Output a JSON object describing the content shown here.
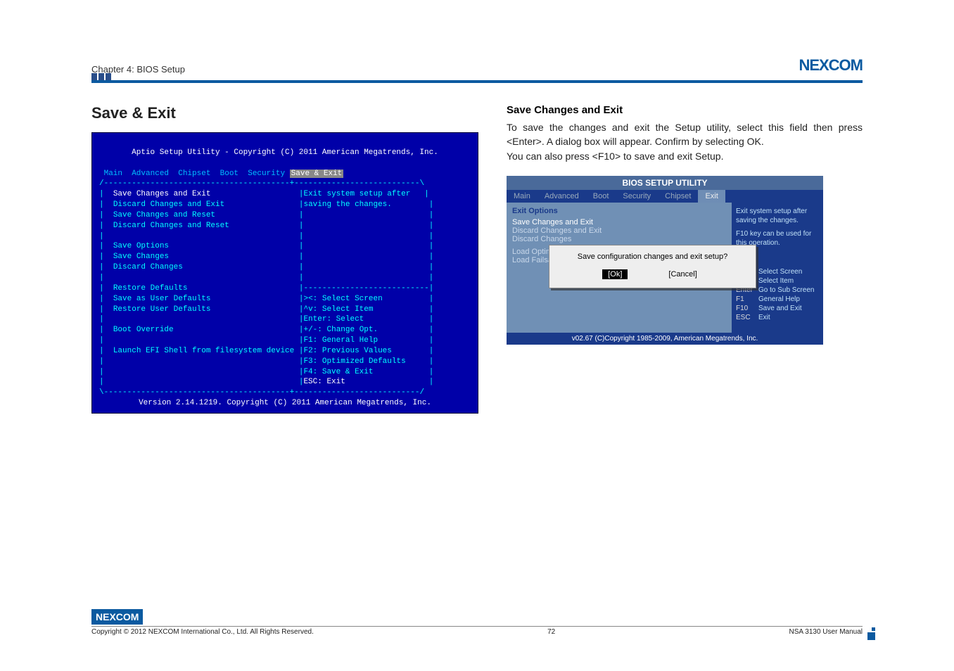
{
  "header": {
    "chapter": "Chapter 4: BIOS Setup",
    "logo_text": "NEXCOM"
  },
  "left": {
    "heading": "Save & Exit",
    "bios": {
      "title": "Aptio Setup Utility - Copyright (C) 2011 American Megatrends, Inc.",
      "tabs": " Main  Advanced  Chipset  Boot  Security ",
      "tab_active": "Save & Exit",
      "menu": {
        "m1": "Save Changes and Exit",
        "m2": "Discard Changes and Exit",
        "m3": "Save Changes and Reset",
        "m4": "Discard Changes and Reset",
        "g1": "Save Options",
        "m5": "Save Changes",
        "m6": "Discard Changes",
        "m7": "Restore Defaults",
        "m8": "Save as User Defaults",
        "m9": "Restore User Defaults",
        "g2": "Boot Override",
        "m10": "Launch EFI Shell from filesystem device"
      },
      "help1": "Exit system setup after",
      "help2": "saving the changes.",
      "keys": {
        "k1": "><: Select Screen",
        "k2": "^v: Select Item",
        "k3": "Enter: Select",
        "k4": "+/-: Change Opt.",
        "k5": "F1: General Help",
        "k6": "F2: Previous Values",
        "k7": "F3: Optimized Defaults",
        "k8": "F4: Save & Exit",
        "k9": "ESC: Exit"
      },
      "footer": "Version 2.14.1219. Copyright (C) 2011 American Megatrends, Inc."
    }
  },
  "right": {
    "title": "Save Changes and Exit",
    "body1": "To save the changes and exit the Setup utility, select this field then press <Enter>. A dialog box will appear. Confirm by selecting OK.",
    "body2": "You can also press <F10> to save and exit Setup.",
    "bios2": {
      "header": "BIOS SETUP UTILITY",
      "tabs": {
        "t1": "Main",
        "t2": "Advanced",
        "t3": "Boot",
        "t4": "Security",
        "t5": "Chipset",
        "t6": "Exit"
      },
      "left": {
        "head": "Exit Options",
        "i1": "Save Changes and Exit",
        "i2": "Discard Changes and Exit",
        "i3": "Discard Changes",
        "i4": "Load Optimal D",
        "i5": "Load Failsafe D"
      },
      "rightpanel": {
        "l1": "Exit system setup after saving the changes.",
        "l2": "F10 key can be used for this operation.",
        "h1": "Select Screen",
        "h2": "Select Item",
        "h3": "Go to Sub Screen",
        "h4": "General Help",
        "h5": "Save and Exit",
        "h6": "Exit",
        "k1": "↑↓",
        "k2": "↔",
        "k3": "Enter",
        "k4": "F1",
        "k5": "F10",
        "k6": "ESC"
      },
      "dialog": {
        "msg": "Save configuration changes and exit setup?",
        "ok": "[Ok]",
        "cancel": "[Cancel]"
      },
      "footer": "v02.67 (C)Copyright 1985-2009, American Megatrends, Inc."
    }
  },
  "footer": {
    "logo": "NEXCOM",
    "copyright": "Copyright © 2012 NEXCOM International Co., Ltd. All Rights Reserved.",
    "page": "72",
    "manual": "NSA 3130 User Manual"
  }
}
